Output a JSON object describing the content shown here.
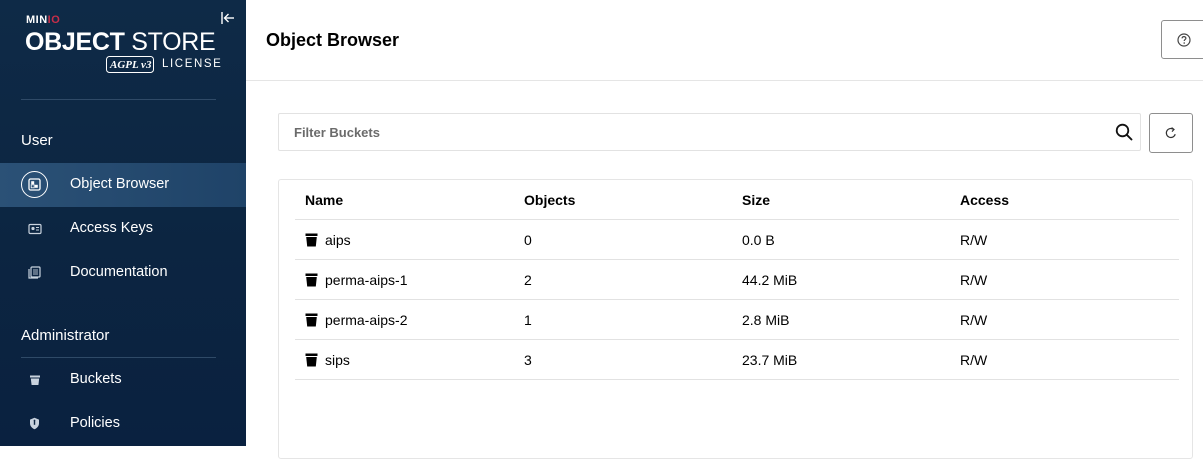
{
  "sidebar": {
    "logo": {
      "brand": "MINIO",
      "title_bold": "OBJECT",
      "title_thin": "STORE",
      "badge": "AGPL v3",
      "license": "LICENSE"
    },
    "sections": [
      {
        "label": "User",
        "items": [
          {
            "label": "Object Browser",
            "icon": "object-browser-icon",
            "active": true
          },
          {
            "label": "Access Keys",
            "icon": "access-keys-icon",
            "active": false
          },
          {
            "label": "Documentation",
            "icon": "documentation-icon",
            "active": false
          }
        ]
      },
      {
        "label": "Administrator",
        "items": [
          {
            "label": "Buckets",
            "icon": "bucket-icon",
            "active": false
          },
          {
            "label": "Policies",
            "icon": "policy-icon",
            "active": false
          }
        ]
      }
    ]
  },
  "header": {
    "title": "Object Browser",
    "help_icon": "help-icon"
  },
  "filter": {
    "placeholder": "Filter Buckets",
    "value": ""
  },
  "table": {
    "columns": [
      "Name",
      "Objects",
      "Size",
      "Access"
    ],
    "rows": [
      {
        "name": "aips",
        "objects": "0",
        "size": "0.0 B",
        "access": "R/W"
      },
      {
        "name": "perma-aips-1",
        "objects": "2",
        "size": "44.2 MiB",
        "access": "R/W"
      },
      {
        "name": "perma-aips-2",
        "objects": "1",
        "size": "2.8 MiB",
        "access": "R/W"
      },
      {
        "name": "sips",
        "objects": "3",
        "size": "23.7 MiB",
        "access": "R/W"
      }
    ]
  },
  "colors": {
    "sidebar_bg": "#0e2a47",
    "active_item_bg": "#2b5176",
    "brand_red": "#c72e49"
  }
}
